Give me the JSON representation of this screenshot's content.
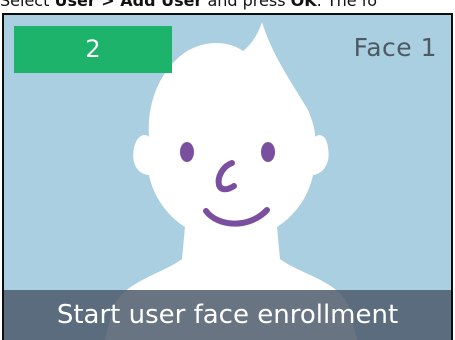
{
  "instruction": {
    "prefix": "Select ",
    "menu_path": "User > Add User",
    "middle": " and press ",
    "key": "OK",
    "suffix": ". The fo"
  },
  "screen": {
    "count": "2",
    "face_label": "Face 1",
    "status": "Start user face enrollment"
  },
  "colors": {
    "background": "#a9cfe0",
    "badge": "#1db36a",
    "face": "#ffffff",
    "features": "#7b4fa0",
    "status_bar": "#485668"
  },
  "icons": {
    "face": "face-illustration-icon"
  }
}
